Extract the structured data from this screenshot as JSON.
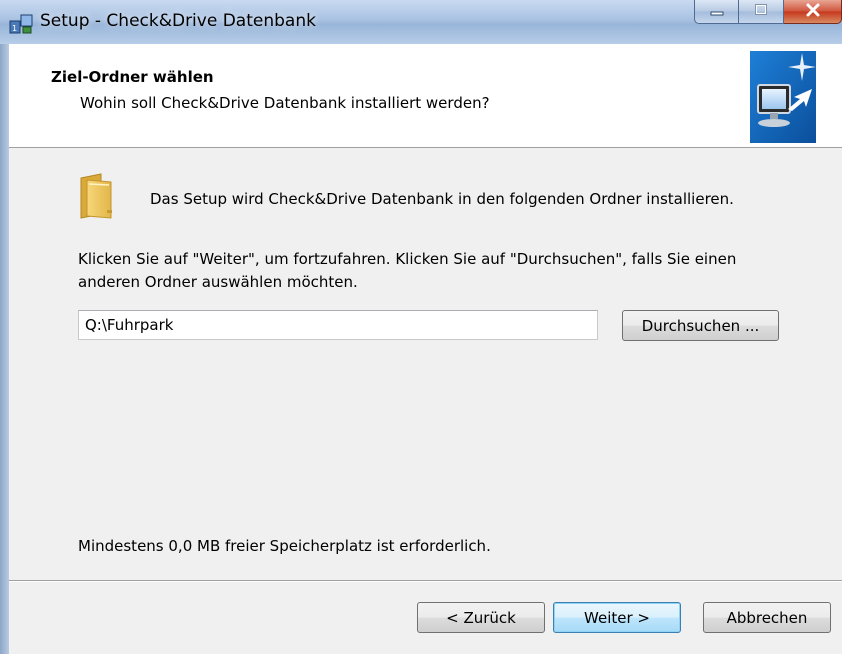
{
  "window": {
    "title": "Setup - Check&Drive Datenbank",
    "app_icon": "setup-icon",
    "caption_buttons": [
      "minimize-icon",
      "maximize-icon",
      "close-icon"
    ]
  },
  "header": {
    "heading": "Ziel-Ordner wählen",
    "subheading": "Wohin soll Check&Drive Datenbank installiert werden?",
    "image": "install-monitor-icon"
  },
  "content": {
    "folder_icon": "folder-icon",
    "intro": "Das Setup wird Check&Drive Datenbank in den folgenden Ordner installieren.",
    "instructions": "Klicken Sie auf \"Weiter\", um fortzufahren. Klicken Sie auf \"Durchsuchen\", falls Sie einen anderen Ordner auswählen möchten.",
    "path_value": "Q:\\Fuhrpark",
    "browse_label": "Durchsuchen ...",
    "space_required": "Mindestens 0,0 MB freier Speicherplatz ist erforderlich."
  },
  "footer": {
    "back_label": "< Zurück",
    "next_label": "Weiter >",
    "cancel_label": "Abbrechen"
  },
  "colors": {
    "content_bg": "#f0f0f0",
    "header_bg": "#ffffff",
    "default_button_border": "#3c7fb1",
    "close_button": "#c5371c"
  }
}
